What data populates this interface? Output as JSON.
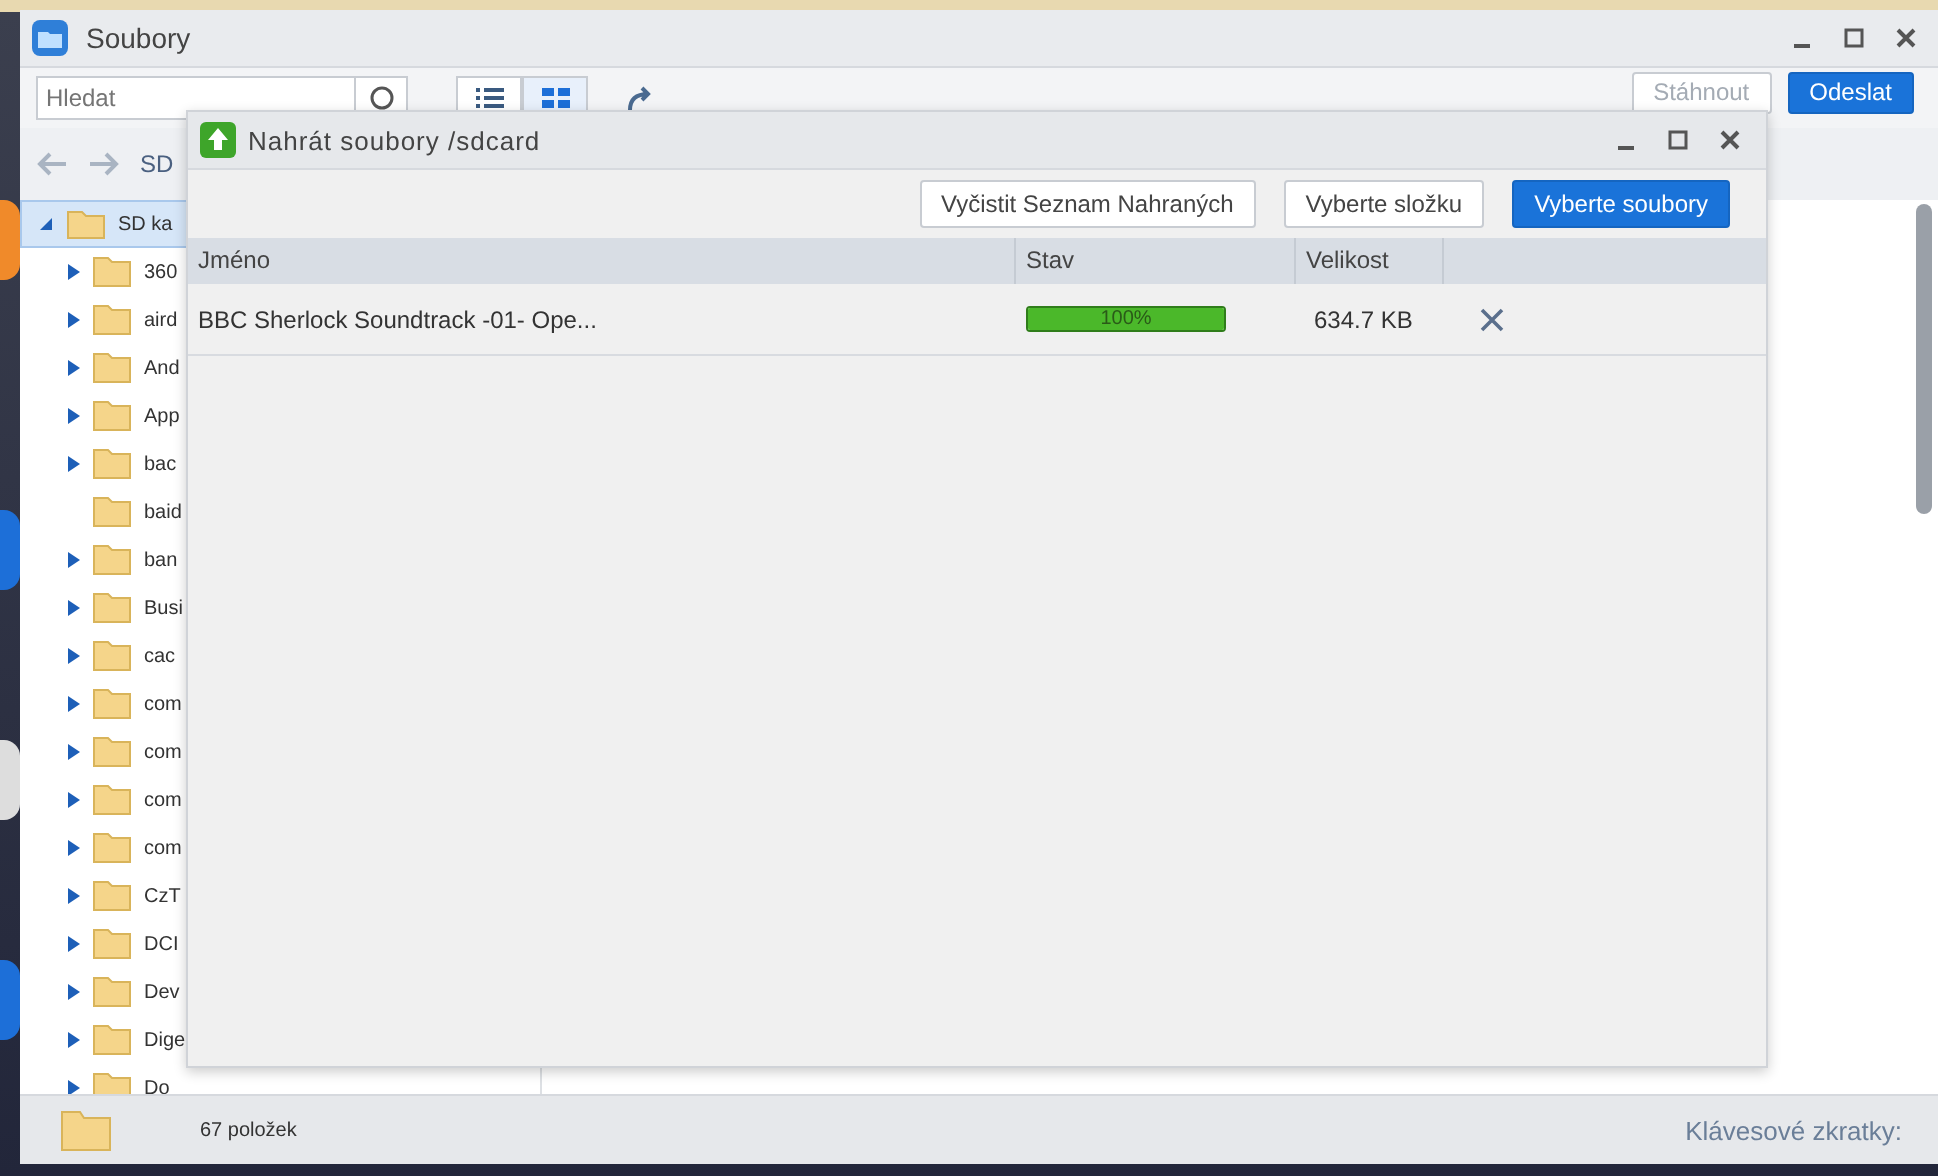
{
  "window": {
    "title": "Soubory"
  },
  "toolbar": {
    "search": {
      "placeholder": "Hledat"
    },
    "view_toggle": [
      {
        "kind": "list",
        "selected": false
      },
      {
        "kind": "grid",
        "selected": true
      }
    ],
    "buttons": [
      {
        "label": "Stáhnout",
        "disabled": true,
        "primary": false
      },
      {
        "label": "Odeslat",
        "disabled": false,
        "primary": true
      }
    ]
  },
  "breadcrumb": "SD",
  "tree": {
    "label": "SD ka",
    "expanded": true,
    "selected": true,
    "children": [
      {
        "label": "360",
        "expandable": true
      },
      {
        "label": "aird",
        "expandable": true
      },
      {
        "label": "And",
        "expandable": true
      },
      {
        "label": "App",
        "expandable": true
      },
      {
        "label": "bac",
        "expandable": true
      },
      {
        "label": "baid",
        "expandable": false
      },
      {
        "label": "ban",
        "expandable": true
      },
      {
        "label": "Busi",
        "expandable": true
      },
      {
        "label": "cac",
        "expandable": true
      },
      {
        "label": "com",
        "expandable": true
      },
      {
        "label": "com",
        "expandable": true
      },
      {
        "label": "com",
        "expandable": true
      },
      {
        "label": "com",
        "expandable": true
      },
      {
        "label": "CzT",
        "expandable": true
      },
      {
        "label": "DCI",
        "expandable": true
      },
      {
        "label": "Dev",
        "expandable": true
      },
      {
        "label": "Dige",
        "expandable": true
      },
      {
        "label": "Do",
        "expandable": true
      }
    ]
  },
  "status_bar": {
    "count": "67 položek",
    "shortcuts": "Klávesové zkratky:"
  },
  "dialog": {
    "title": "Nahrát soubory /sdcard",
    "buttons": [
      {
        "label": "Vyčistit Seznam Nahraných",
        "primary": false
      },
      {
        "label": "Vyberte složku",
        "primary": false
      },
      {
        "label": "Vyberte soubory",
        "primary": true
      }
    ],
    "columns": [
      "Jméno",
      "Stav",
      "Velikost"
    ],
    "rows": [
      {
        "name": "BBC Sherlock Soundtrack -01- Ope...",
        "level": 1,
        "progress": "100%",
        "size": "634.7 KB"
      }
    ]
  }
}
